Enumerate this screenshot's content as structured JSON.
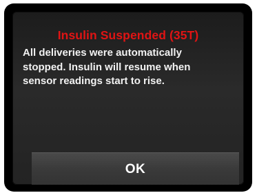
{
  "alert": {
    "title": "Insulin Suspended (35T)",
    "message": "All deliveries were automatically\nstopped. Insulin will resume when\nsensor readings start to rise.",
    "ok_label": "OK"
  },
  "colors": {
    "title": "#e01414",
    "text": "#f2f2f2",
    "background": "#000000",
    "button": "#3a3a3a"
  }
}
